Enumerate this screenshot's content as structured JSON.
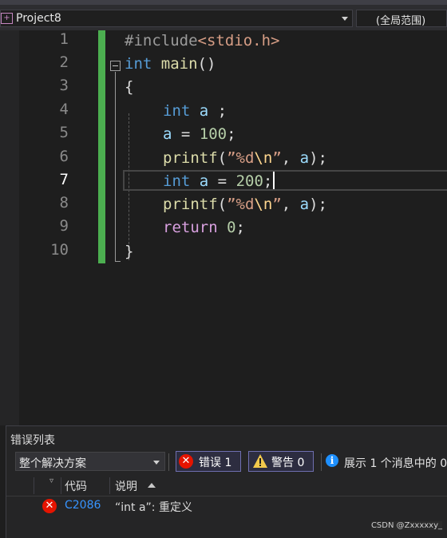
{
  "navbar": {
    "project_name": "Project8",
    "scope": "(全局范围)"
  },
  "editor": {
    "line_numbers": [
      "1",
      "2",
      "3",
      "4",
      "5",
      "6",
      "7",
      "8",
      "9",
      "10"
    ],
    "current_line": "7",
    "code": {
      "l1_directive": "#include",
      "l1_header": "<stdio.h>",
      "l2_kw": "int",
      "l2_fn": "main",
      "l2_rest": "()",
      "l3": "{",
      "l4_kw": "int",
      "l4_var": "a",
      "l4_rest": " ;",
      "l5_var": "a",
      "l5_op": " = ",
      "l5_num": "100",
      "l5_end": ";",
      "l6_fn": "printf",
      "l6_open": "(",
      "l6_str1": "”%d",
      "l6_esc": "\\n",
      "l6_str2": "”",
      "l6_comma": ", ",
      "l6_var": "a",
      "l6_end": ");",
      "l7_kw": "int",
      "l7_var": "a",
      "l7_op": " = ",
      "l7_num": "200",
      "l7_end": ";",
      "l8_fn": "printf",
      "l8_open": "(",
      "l8_str1": "”%d",
      "l8_esc": "\\n",
      "l8_str2": "”",
      "l8_comma": ", ",
      "l8_var": "a",
      "l8_end": ");",
      "l9_kw": "return",
      "l9_num": "0",
      "l9_end": ";",
      "l10": "}"
    }
  },
  "error_list": {
    "title": "错误列表",
    "scope_select": "整个解决方案",
    "errors_label": "错误 1",
    "warnings_label": "警告 0",
    "info_text": "展示 1 个消息中的 0",
    "columns": {
      "code": "代码",
      "description": "说明"
    },
    "rows": [
      {
        "code": "C2086",
        "description": "“int a”: 重定义"
      }
    ]
  },
  "watermark": "CSDN @Zxxxxxy_",
  "colors": {
    "accent": "#569cd6",
    "change_bar": "#4caf50",
    "error": "#e51400",
    "warning": "#f2c94c",
    "info": "#1e90ff"
  },
  "icons": [
    "project-icon",
    "chevron-down-icon",
    "error-icon",
    "warning-icon",
    "info-icon",
    "sort-ascending-icon",
    "filter-icon",
    "collapse-icon"
  ]
}
